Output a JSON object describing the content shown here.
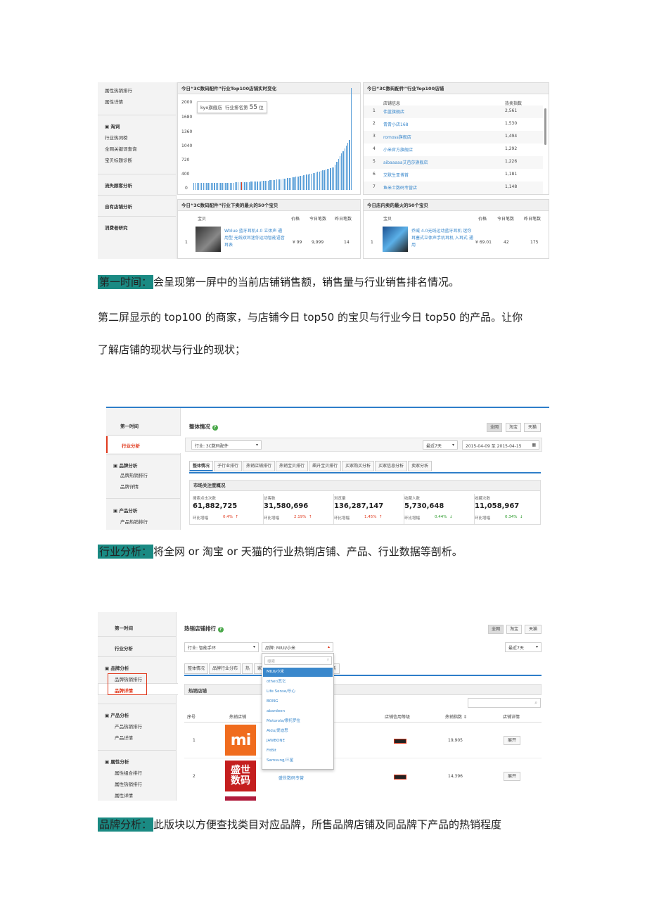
{
  "shot1": {
    "sidebar": [
      "属性热销排行",
      "属性详情",
      "淘词",
      "行业热词榜",
      "全网关键词查询",
      "宝贝标题诊断",
      "流失顾客分析",
      "自有店铺分析",
      "消费者研究"
    ],
    "chart_title": "今日“3C数码配件”行业Top100店铺实时变化",
    "tooltip_shop": "kyo旗舰店",
    "tooltip_rank_label": "行业排名第",
    "tooltip_rank": "55",
    "tooltip_unit": "位",
    "y_ticks": [
      "2000",
      "1680",
      "1360",
      "1040",
      "720",
      "400",
      "0"
    ],
    "top_title": "今日“3C数码配件”行业Top100店铺",
    "col_shop": "店铺信息",
    "col_index": "热卖指数",
    "shops": [
      {
        "rank": "1",
        "name": "伟蓝旗舰店",
        "index": "2,561"
      },
      {
        "rank": "2",
        "name": "青青小店168",
        "index": "1,530"
      },
      {
        "rank": "3",
        "name": "romoss旗舰店",
        "index": "1,494"
      },
      {
        "rank": "4",
        "name": "小米官方旗舰店",
        "index": "1,292"
      },
      {
        "rank": "5",
        "name": "aibaaaaa艾芭莎旗舰店",
        "index": "1,226"
      },
      {
        "rank": "6",
        "name": "艾默生亚博首",
        "index": "1,181"
      },
      {
        "rank": "7",
        "name": "鱼米士数码专营店",
        "index": "1,148"
      }
    ],
    "p3_title": "今日“3C数码配件”行业下卖的最火的50个宝贝",
    "p4_title": "今日店内卖的最火的50个宝贝",
    "col_item": "宝贝",
    "col_price": "价格",
    "col_today": "今日笔数",
    "col_yest": "昨日笔数",
    "item1": {
      "rank": "1",
      "title": "Wblue 蓝牙耳机4.0 立体声 通用型 无线双耳迷你运动智能语音耳表",
      "price": "¥ 99",
      "today": "9,999",
      "yest": "14"
    },
    "item2": {
      "rank": "1",
      "title": "乔威 4.0无线运动蓝牙耳机 迷你 耳塞式立体声手机耳机 入耳式 通用",
      "price": "¥ 69.01",
      "today": "42",
      "yest": "175"
    }
  },
  "p1": {
    "tag": "第一时间：",
    "text": "会呈现第一屏中的当前店铺销售额，销售量与行业销售排名情况。"
  },
  "p2": {
    "line1": "第二屏显示的 top100 的商家，与店铺今日 top50 的宝贝与行业今日 top50 的产品。让你",
    "line2": "了解店铺的现状与行业的现状；"
  },
  "shot2": {
    "sidebar": [
      "第一时间",
      "行业分析",
      "品牌分析",
      "品牌热销排行",
      "品牌详情",
      "产品分析",
      "产品热销排行"
    ],
    "title": "整体情况",
    "scope": [
      "全网",
      "淘宝",
      "天猫"
    ],
    "industry": "行业: 3C数码配件",
    "period": "最近7天",
    "date_range": "2015-04-09 至 2015-04-15",
    "tabs": [
      "整体情况",
      "子行业排行",
      "热销店铺排行",
      "热销宝贝排行",
      "飙升宝贝排行",
      "买家购买分析",
      "买家信息分析",
      "卖家分析"
    ],
    "market_title": "市场关注度概况",
    "ring_label": "环比增幅",
    "metrics": [
      {
        "label": "搜索点击次数",
        "value": "61,882,725",
        "change": "0.4%",
        "dir": "↑"
      },
      {
        "label": "访客数",
        "value": "31,580,696",
        "change": "2.19%",
        "dir": "↑"
      },
      {
        "label": "浏览量",
        "value": "136,287,147",
        "change": "1.45%",
        "dir": "↑"
      },
      {
        "label": "收藏人数",
        "value": "5,730,648",
        "change": "0.44%",
        "dir": "↓"
      },
      {
        "label": "收藏次数",
        "value": "11,058,967",
        "change": "0.34%",
        "dir": "↓"
      }
    ]
  },
  "p3": {
    "tag": "行业分析：",
    "text": "将全网 or 淘宝 or 天猫的行业热销店铺、产品、行业数据等剖析。"
  },
  "shot3": {
    "sidebar": [
      "第一时间",
      "行业分析",
      "品牌分析",
      "品牌热销排行",
      "品牌详情",
      "产品分析",
      "产品热销排行",
      "产品详情",
      "属性分析",
      "属性组合排行",
      "属性热销排行",
      "属性详情"
    ],
    "title": "热销店铺排行",
    "scope": [
      "全网",
      "淘宝",
      "天猫"
    ],
    "industry": "行业: 智能手环",
    "brand": "品牌: MIUI/小米",
    "period": "最近7天",
    "search_placeholder": "搜索",
    "brands": [
      "MIUI/小米",
      "other/其它",
      "Life Sense/乐心",
      "BONG",
      "abardeen",
      "Motorola/摩托罗拉",
      "Aidu/爱迪思",
      "JAWBONE",
      "FitBit",
      "Samsung/三星"
    ],
    "tabs": [
      "整体情况",
      "品牌行业分布",
      "热",
      "家购买分析",
      "买家信息分析",
      "卖家分析"
    ],
    "section": "热销店铺",
    "cols": [
      "序号",
      "热销店铺",
      "店铺信用等级",
      "热销指数",
      "店铺详情"
    ],
    "rows": [
      {
        "no": "1",
        "logo": "mi",
        "shop": "",
        "index": "19,905",
        "action": "展开"
      },
      {
        "no": "2",
        "logo": "盛世数码",
        "shop": "盛世数码专营",
        "index": "14,396",
        "action": "展开"
      }
    ]
  },
  "p4": {
    "tag": "品牌分析：",
    "text": "此版块以方便查找类目对应品牌，所售品牌店铺及同品牌下产品的热销程度"
  },
  "colors": {
    "accent": "#1a8a83",
    "link": "#3a88cc",
    "up": "#e0391d",
    "down": "#2a9a2a"
  }
}
